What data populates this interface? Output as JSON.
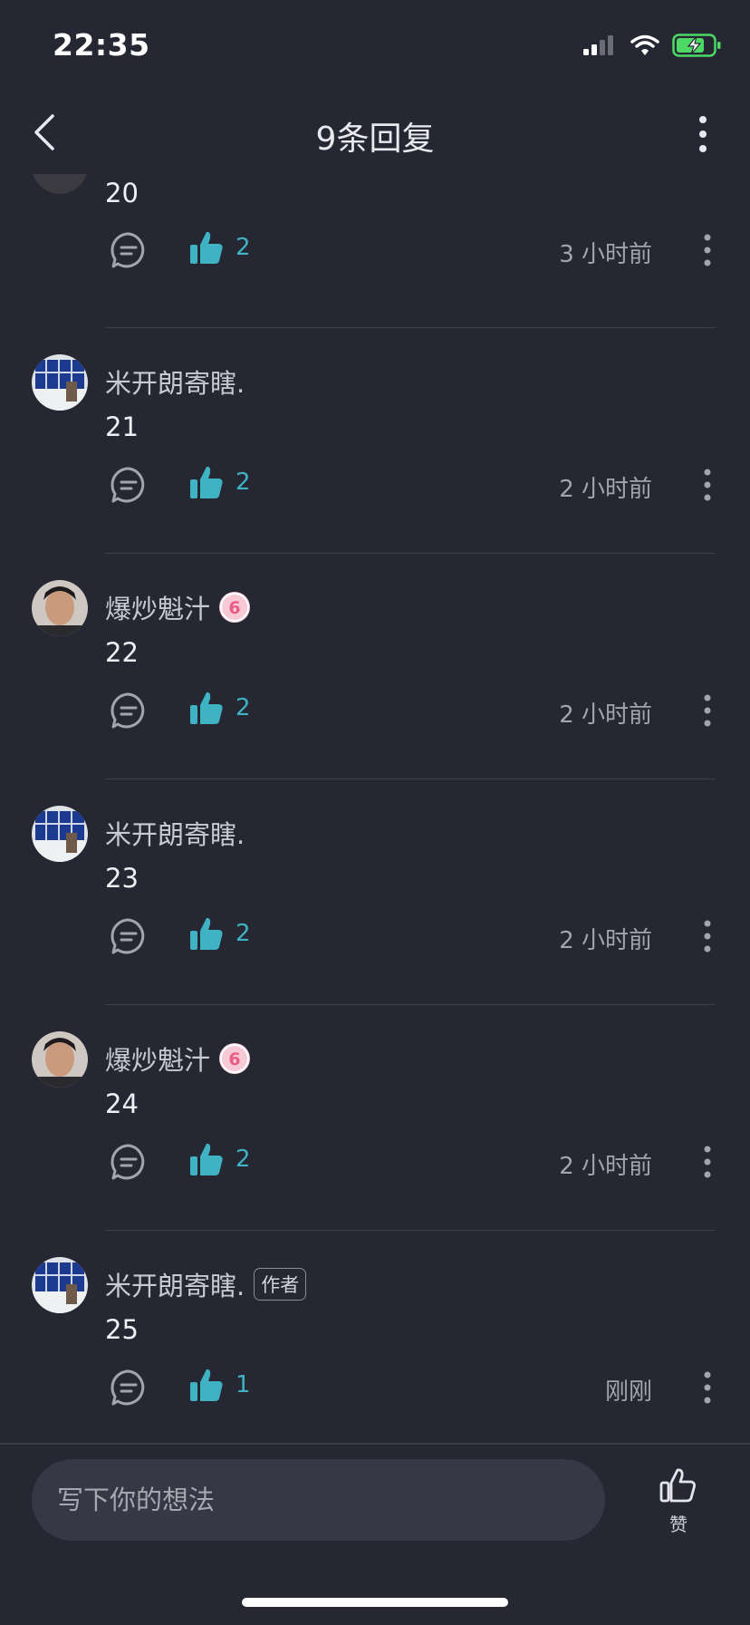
{
  "status_bar": {
    "time": "22:35"
  },
  "nav": {
    "title": "9条回复"
  },
  "comments": [
    {
      "username": "",
      "level_badge": false,
      "author_badge": false,
      "content": "20",
      "likes": "2",
      "time": "3 小时前",
      "avatar": "partial-hidden"
    },
    {
      "username": "米开朗寄瞎.",
      "level_badge": false,
      "author_badge": false,
      "content": "21",
      "likes": "2",
      "time": "2 小时前",
      "avatar": "building-photo"
    },
    {
      "username": "爆炒魁汁",
      "level_badge": true,
      "author_badge": false,
      "content": "22",
      "likes": "2",
      "time": "2 小时前",
      "avatar": "portrait-photo"
    },
    {
      "username": "米开朗寄瞎.",
      "level_badge": false,
      "author_badge": false,
      "content": "23",
      "likes": "2",
      "time": "2 小时前",
      "avatar": "building-photo"
    },
    {
      "username": "爆炒魁汁",
      "level_badge": true,
      "author_badge": false,
      "content": "24",
      "likes": "2",
      "time": "2 小时前",
      "avatar": "portrait-photo"
    },
    {
      "username": "米开朗寄瞎.",
      "level_badge": false,
      "author_badge": true,
      "content": "25",
      "likes": "1",
      "time": "刚刚",
      "avatar": "building-photo"
    }
  ],
  "labels": {
    "author_badge": "作者",
    "level_badge_glyph": "6"
  },
  "bottom_bar": {
    "input_placeholder": "写下你的想法",
    "like_label": "赞"
  },
  "colors": {
    "background": "#252733",
    "accent": "#3fb2c3",
    "badge_pink": "#f7c9d6",
    "battery_green": "#4cd964"
  },
  "icons": {
    "back": "chevron-left-icon",
    "more": "more-vertical-icon",
    "reply": "comment-bubble-icon",
    "like": "thumbs-up-icon"
  }
}
